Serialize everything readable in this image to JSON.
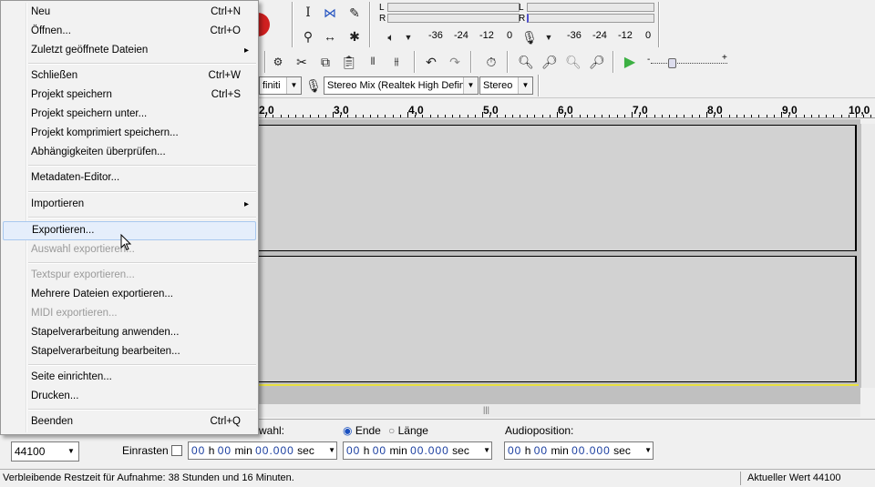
{
  "menu": {
    "items": [
      {
        "label": "Neu",
        "shortcut": "Ctrl+N"
      },
      {
        "label": "Öffnen...",
        "shortcut": "Ctrl+O"
      },
      {
        "label": "Zuletzt geöffnete Dateien",
        "shortcut": ""
      },
      {
        "label": "Schließen",
        "shortcut": "Ctrl+W"
      },
      {
        "label": "Projekt speichern",
        "shortcut": "Ctrl+S"
      },
      {
        "label": "Projekt speichern unter...",
        "shortcut": ""
      },
      {
        "label": "Projekt komprimiert speichern...",
        "shortcut": ""
      },
      {
        "label": "Abhängigkeiten überprüfen...",
        "shortcut": ""
      },
      {
        "label": "Metadaten-Editor...",
        "shortcut": ""
      },
      {
        "label": "Importieren",
        "shortcut": ""
      },
      {
        "label": "Exportieren...",
        "shortcut": ""
      },
      {
        "label": "Auswahl exportieren...",
        "shortcut": ""
      },
      {
        "label": "Textspur exportieren...",
        "shortcut": ""
      },
      {
        "label": "Mehrere Dateien exportieren...",
        "shortcut": ""
      },
      {
        "label": "MIDI exportieren...",
        "shortcut": ""
      },
      {
        "label": "Stapelverarbeitung anwenden...",
        "shortcut": ""
      },
      {
        "label": "Stapelverarbeitung bearbeiten...",
        "shortcut": ""
      },
      {
        "label": "Seite einrichten...",
        "shortcut": ""
      },
      {
        "label": "Drucken...",
        "shortcut": ""
      },
      {
        "label": "Beenden",
        "shortcut": "Ctrl+Q"
      }
    ]
  },
  "meters": {
    "play": {
      "l": "L",
      "r": "R"
    },
    "rec": {
      "l": "L",
      "r": "R"
    },
    "scale_left": [
      "-36",
      "-24",
      "-12",
      "0"
    ],
    "scale_right": [
      "-36",
      "-24",
      "-12",
      "0"
    ]
  },
  "device": {
    "host_partial": "finiti",
    "input": "Stereo Mix (Realtek High Defini",
    "channels": "Stereo"
  },
  "ruler": {
    "ticks": [
      "2,0",
      "3,0",
      "4,0",
      "5,0",
      "6,0",
      "7,0",
      "8,0",
      "9,0",
      "10,0"
    ]
  },
  "selection": {
    "rate": "44100",
    "snap_label": "Einrasten",
    "selection_label_partial": "wahl:",
    "end_label": "Ende",
    "length_label": "Länge",
    "audio_pos_label": "Audioposition:",
    "t1": {
      "h": "00",
      "m": "00",
      "s": "00.000"
    },
    "t2": {
      "h": "00",
      "m": "00",
      "s": "00.000"
    },
    "t3": {
      "h": "00",
      "m": "00",
      "s": "00.000"
    },
    "unit_h": "h",
    "unit_min": "min",
    "unit_sec": "sec"
  },
  "status": {
    "left": "Verbleibende Restzeit für Aufnahme: 38 Stunden und 16 Minuten.",
    "right": "Aktueller Wert 44100"
  },
  "colors": {
    "play_green": "#3cb043",
    "record_red": "#d02020",
    "menu_highlight": "#e5eefb"
  }
}
